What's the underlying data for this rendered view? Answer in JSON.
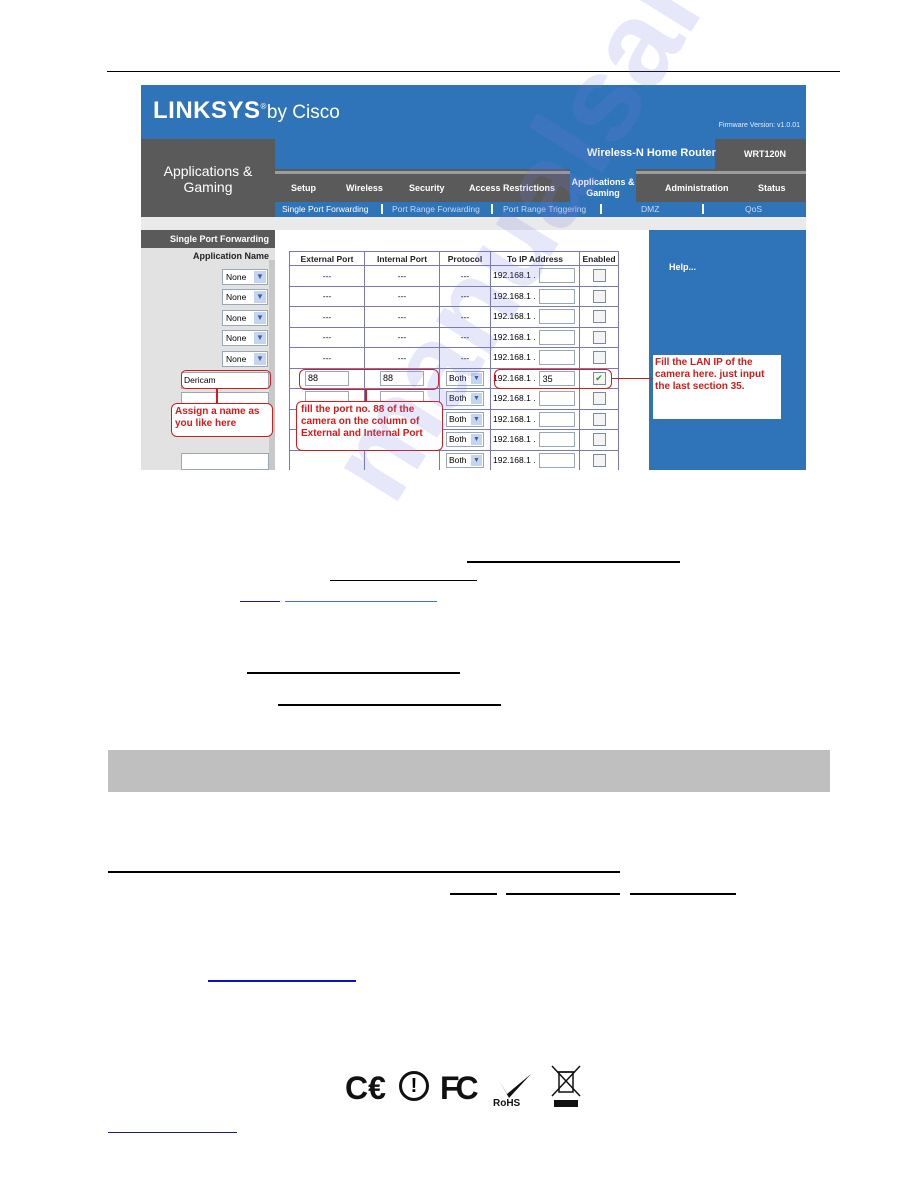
{
  "router_ui": {
    "brand": "LINKSYS",
    "brand_suffix": "by Cisco",
    "registered_mark": "®",
    "firmware": "Firmware Version: v1.0.01",
    "section_title": "Applications & Gaming",
    "router_name": "Wireless-N Home Router",
    "model": "WRT120N",
    "tabs": [
      {
        "label": "Setup"
      },
      {
        "label": "Wireless"
      },
      {
        "label": "Security"
      },
      {
        "label": "Access Restrictions"
      },
      {
        "label": "Applications & Gaming",
        "active": true
      },
      {
        "label": "Administration"
      },
      {
        "label": "Status"
      }
    ],
    "subtabs": [
      {
        "label": "Single Port Forwarding",
        "active": true
      },
      {
        "label": "Port Range Forwarding"
      },
      {
        "label": "Port Range Triggering"
      },
      {
        "label": "DMZ"
      },
      {
        "label": "QoS"
      }
    ],
    "left_heading": "Single Port Forwarding",
    "app_name_label": "Application Name",
    "app_select_value": "None",
    "custom_app_name": "Dericam",
    "columns": [
      "External Port",
      "Internal Port",
      "Protocol",
      "To IP Address",
      "Enabled"
    ],
    "placeholder_dash": "---",
    "ip_prefix": "192.168.1",
    "custom_row": {
      "external_port": "88",
      "internal_port": "88",
      "protocol": "Both",
      "ip_last": "35",
      "enabled": true
    },
    "protocol_default": "Both",
    "help_label": "Help...",
    "checkmark": "✔",
    "select_arrow": "▼"
  },
  "annotations": {
    "name_note": "Assign a name as you like here",
    "port_note": "fill the port no. 88 of the camera on the column of External and Internal Port",
    "ip_note": "Fill the LAN IP of the camera here. just input the last section 35."
  },
  "certifications": {
    "ce": "C€",
    "warning": "ⓘ",
    "fcc": "FC",
    "rohs": "RoHS",
    "weee": "WEEE"
  },
  "watermark": "manualsarchive.com"
}
